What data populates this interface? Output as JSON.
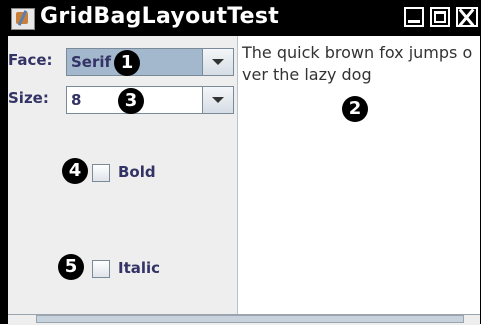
{
  "window": {
    "title": "GridBagLayoutTest"
  },
  "controls": {
    "face_label": "Face:",
    "face_value": "Serif",
    "size_label": "Size:",
    "size_value": "8",
    "bold_label": "Bold",
    "italic_label": "Italic"
  },
  "text_area": {
    "content": "The quick brown fox jumps over the lazy dog"
  },
  "annotations": [
    "1",
    "2",
    "3",
    "4",
    "5"
  ],
  "colors": {
    "selected_combo_bg": "#a3b8cc",
    "label_text": "#333366",
    "panel_bg": "#eeeeee"
  }
}
